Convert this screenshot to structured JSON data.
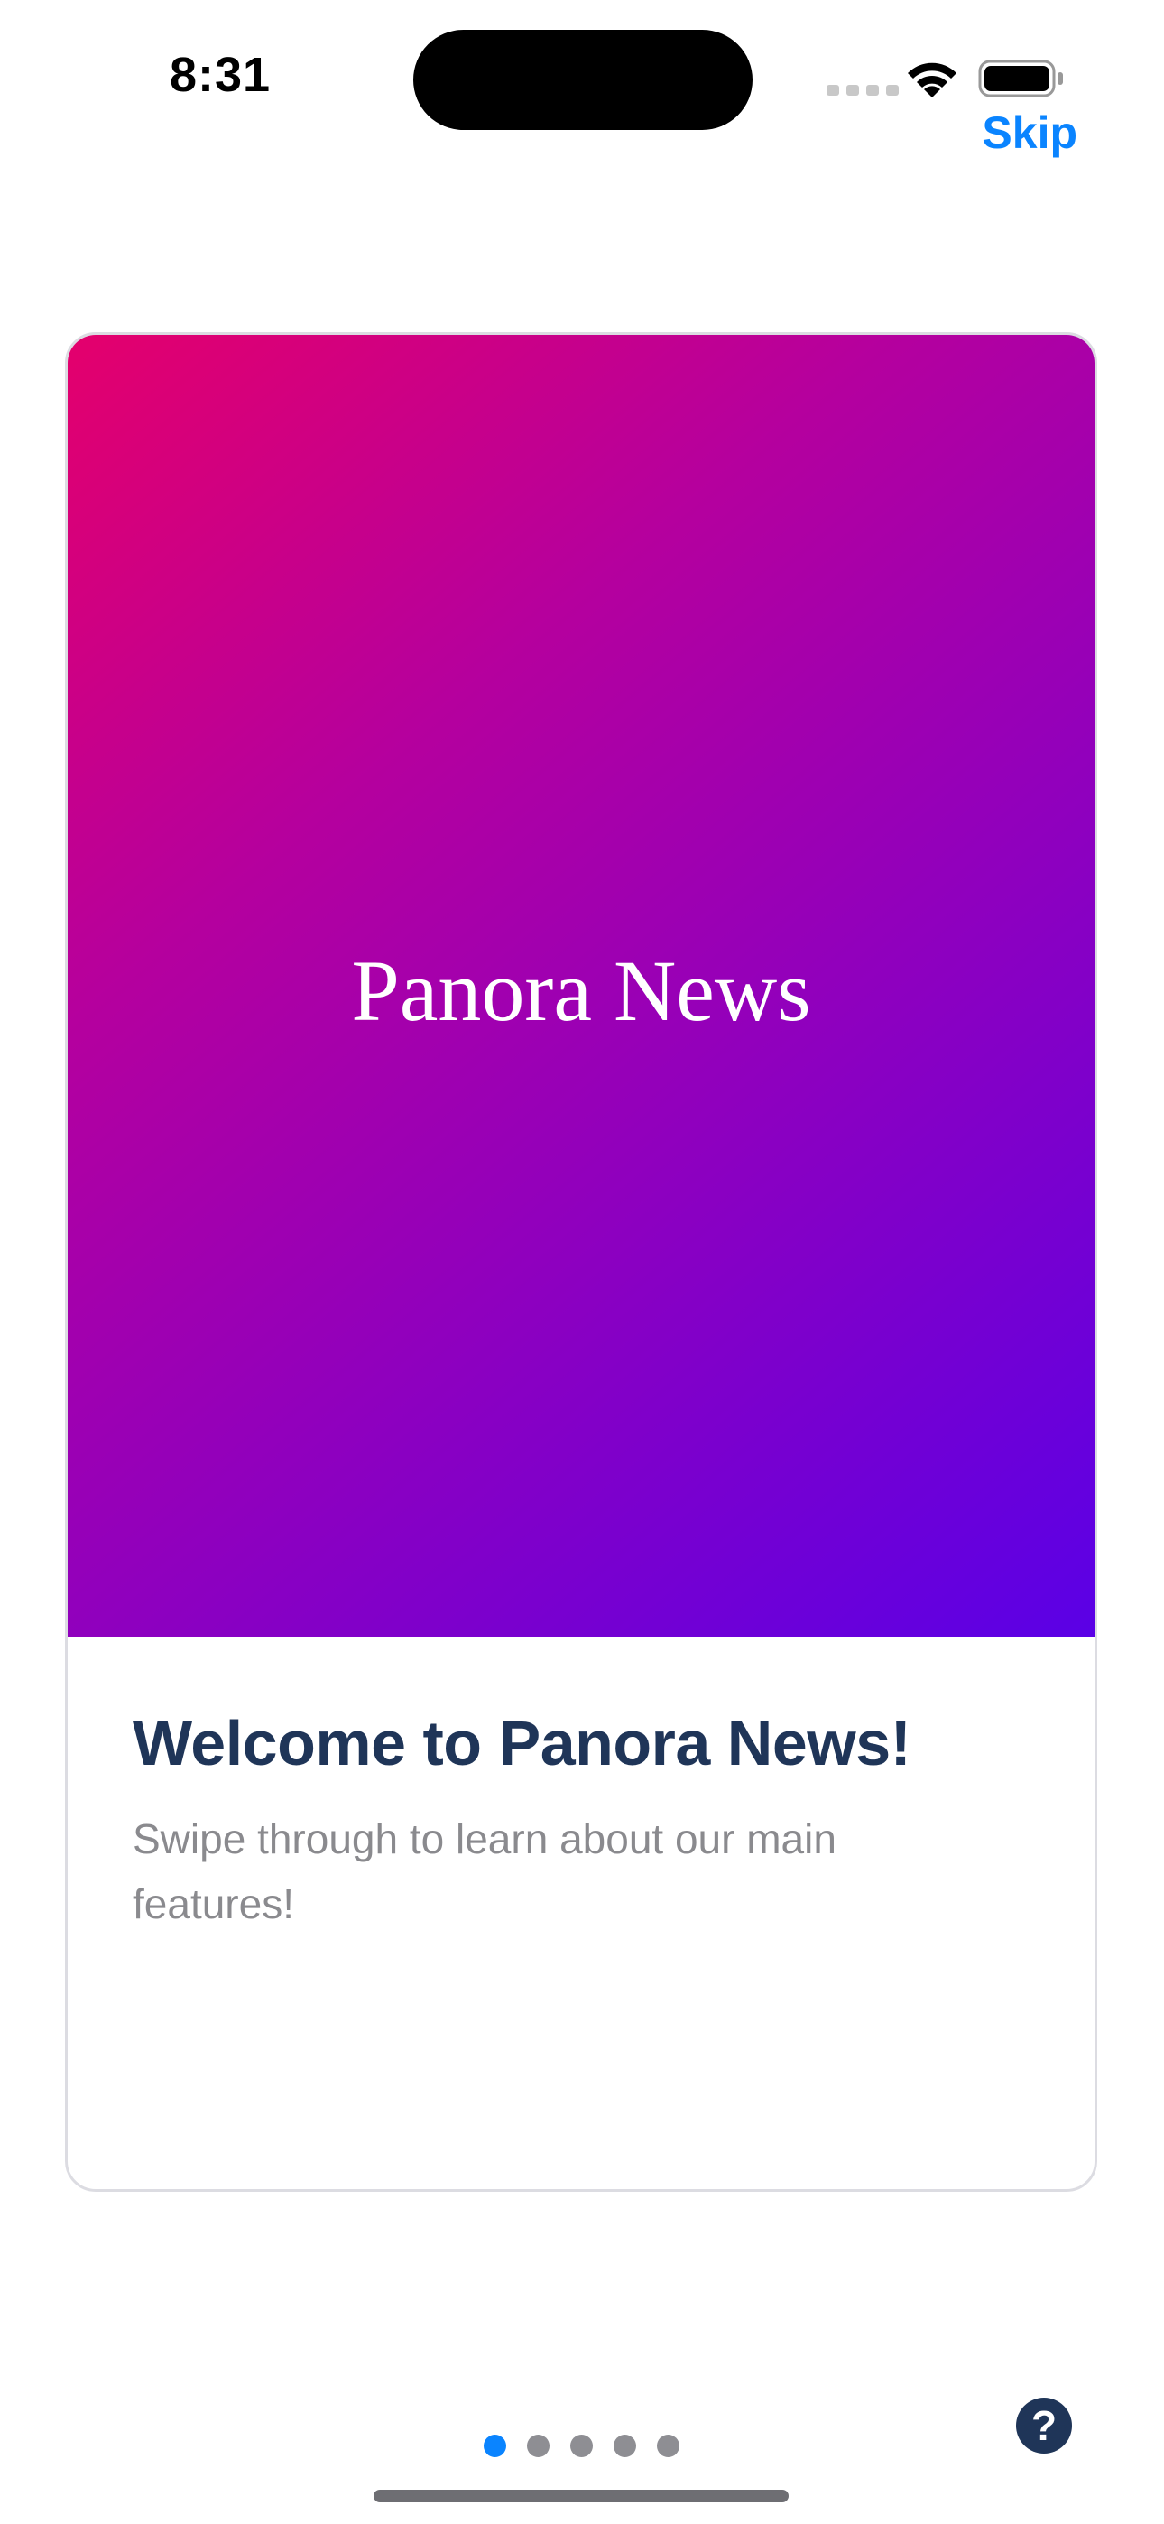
{
  "status_bar": {
    "time": "8:31",
    "signal_icon": "cellular-signal-icon",
    "wifi_icon": "wifi-icon",
    "battery_icon": "battery-icon"
  },
  "header": {
    "skip_label": "Skip"
  },
  "card": {
    "hero_title": "Panora News",
    "title": "Welcome to Panora News!",
    "subtitle": "Swipe through to learn about our main features!",
    "gradient_colors": [
      "#e4006c",
      "#b5009e",
      "#8e00bf",
      "#5a00e6"
    ]
  },
  "pagination": {
    "total": 5,
    "current": 1,
    "active_color": "#0a84ff",
    "inactive_color": "#8e8e93"
  },
  "help": {
    "label": "?",
    "icon": "help-icon"
  },
  "colors": {
    "accent": "#0a84ff",
    "title": "#1f3558",
    "subtitle": "#8a8a8e"
  }
}
